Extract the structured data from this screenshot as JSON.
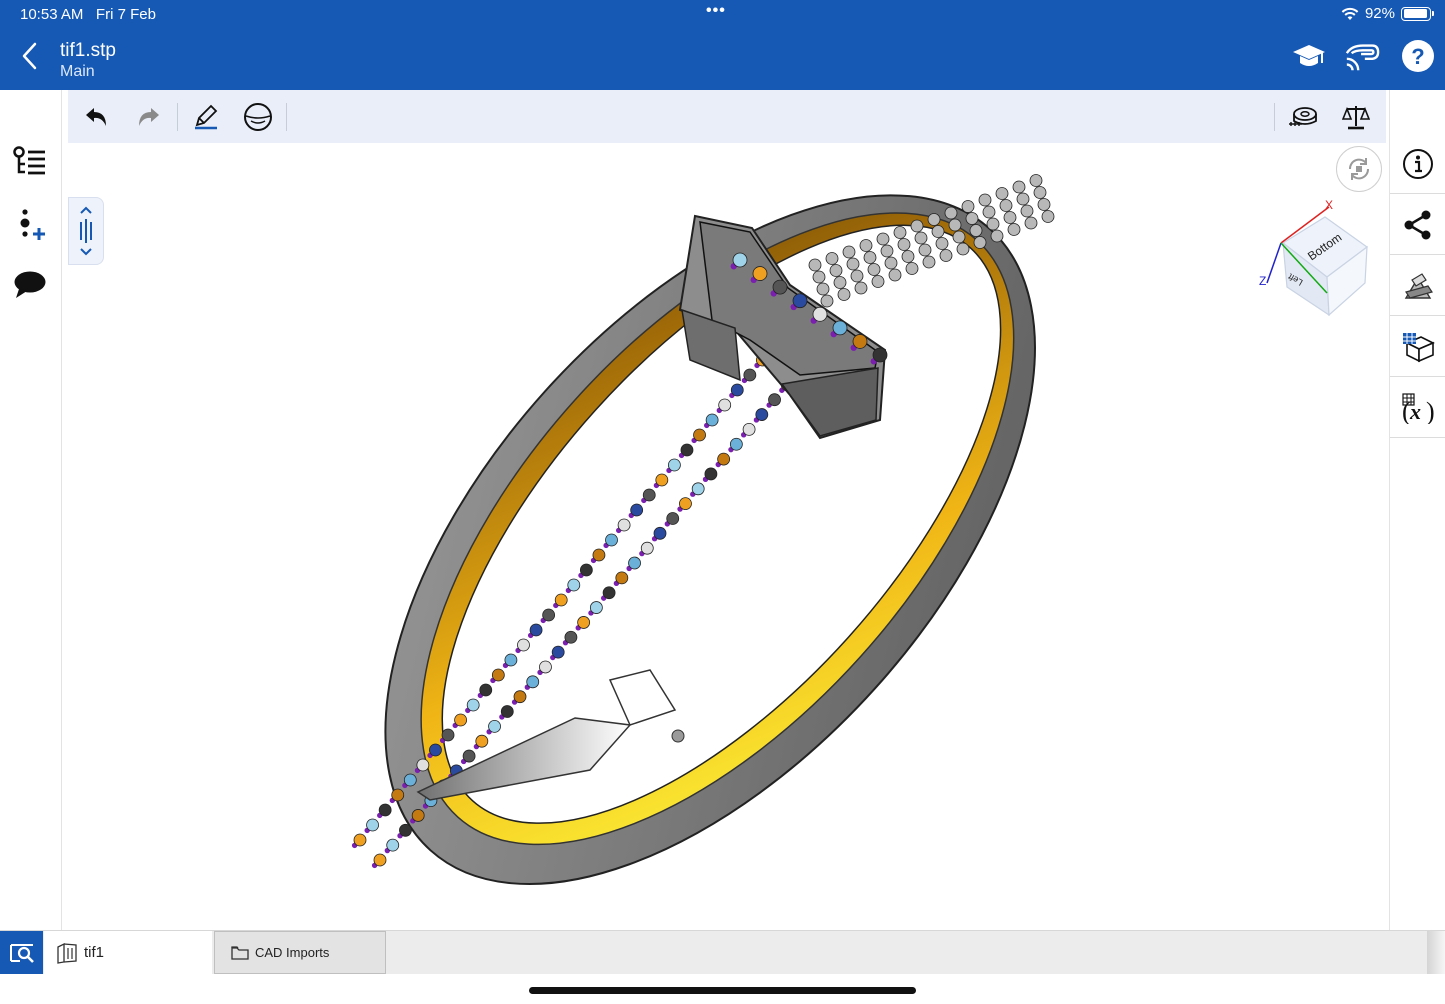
{
  "status_bar": {
    "time": "10:53 AM",
    "date": "Fri 7 Feb",
    "dots": "•••",
    "battery_percent": "92%",
    "battery_level": 0.92
  },
  "header": {
    "title": "tif1.stp",
    "subtitle": "Main",
    "icons": [
      "back-chevron-icon",
      "graduation-cap-icon",
      "cast-icon",
      "help-icon"
    ]
  },
  "left_rail": {
    "icons": [
      "feature-tree-icon",
      "add-mate-icon",
      "comment-icon"
    ]
  },
  "toolbar": {
    "left_icons": [
      "undo-icon",
      "redo-icon",
      "pencil-icon",
      "face-select-icon"
    ],
    "right_icons": [
      "measure-tape-icon",
      "mass-properties-icon"
    ]
  },
  "viewport": {
    "view_cube": {
      "front_face": "Bottom",
      "side_face": "Left",
      "axes": [
        "X",
        "Y",
        "Z"
      ]
    },
    "inner_surface_color": "#f0b515",
    "body_color": "#8a8a8a",
    "gem_accent": "#7a1fb0"
  },
  "right_rail": {
    "icons": [
      "info-icon",
      "share-icon",
      "appearance-icon",
      "display-state-icon",
      "variables-icon"
    ]
  },
  "bottom_bar": {
    "tabs": [
      {
        "label": "tif1",
        "icon": "part-studio-icon"
      },
      {
        "label": "CAD Imports",
        "icon": "folder-icon"
      }
    ]
  },
  "colors": {
    "brand": "#1659b5",
    "toolbar_bg": "#e9eef8"
  }
}
